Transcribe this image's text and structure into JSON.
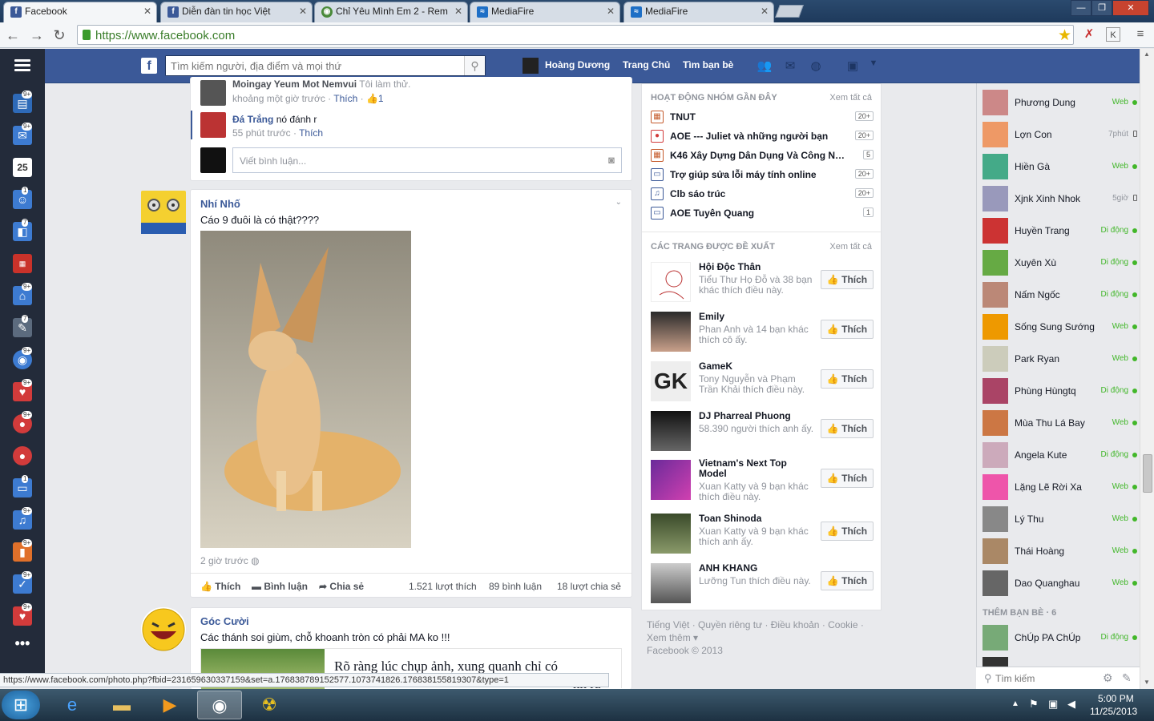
{
  "browser": {
    "tabs": [
      {
        "title": "Facebook",
        "icon": "facebook-icon",
        "active": true
      },
      {
        "title": "Diễn đàn tin học Việt",
        "icon": "facebook-icon"
      },
      {
        "title": "Chỉ Yêu Mình Em 2 - Rem",
        "icon": "chrome-icon"
      },
      {
        "title": "MediaFire",
        "icon": "mediafire-icon"
      },
      {
        "title": "MediaFire",
        "icon": "mediafire-icon"
      }
    ],
    "url": "https://www.facebook.com",
    "status_url": "https://www.facebook.com/photo.php?fbid=231659630337159&set=a.176838789152577.1073741826.176838155819307&type=1"
  },
  "fb_header": {
    "search_placeholder": "Tìm kiếm người, địa điểm và mọi thứ",
    "user_name": "Hoàng Dương",
    "home": "Trang Chủ",
    "find_friends": "Tìm bạn bè"
  },
  "app_badges": [
    "9+",
    "9+",
    "25",
    "1",
    "7",
    "",
    "9+",
    "7",
    "9+",
    "9+",
    "9+",
    "",
    "1",
    "9+",
    "9+",
    "9+",
    "9+"
  ],
  "comments": [
    {
      "name": "Moingay Yeum Mot Nemvui",
      "text": "Tôi làm thử.",
      "time": "khoảng một giờ trước",
      "like": "Thích",
      "likes": "1"
    },
    {
      "name": "Đá Trắng",
      "text": "nó đánh r",
      "time": "55 phút trước",
      "like": "Thích"
    }
  ],
  "comment_placeholder": "Viết bình luận...",
  "post1": {
    "author": "Nhí Nhố",
    "text": "Cáo 9 đuôi là có thật????",
    "time": "2 giờ trước",
    "actions": {
      "like": "Thích",
      "comment": "Bình luận",
      "share": "Chia sẻ"
    },
    "stats": {
      "likes": "1.521 lượt thích",
      "comments": "89 bình luận",
      "shares": "18 lượt chia sẻ"
    }
  },
  "post2": {
    "author": "Góc Cười",
    "text": "Các thánh soi giùm, chỗ khoanh tròn có phải MA ko !!!",
    "preview_text": "Rõ ràng lúc chụp ảnh, xung quanh chỉ có",
    "preview_text2": "nh ra thì..."
  },
  "groups": {
    "heading": "HOẠT ĐỘNG NHÓM GẦN ĐÂY",
    "see_all": "Xem tất cả",
    "items": [
      {
        "name": "TNUT",
        "count": "20+"
      },
      {
        "name": "AOE --- Juliet và những người bạn",
        "count": "20+"
      },
      {
        "name": "K46 Xây Dựng Dân Dụng Và Công Ng...",
        "count": "5"
      },
      {
        "name": "Trợ giúp sửa lỗi máy tính online",
        "count": "20+"
      },
      {
        "name": "Clb sáo trúc",
        "count": "20+"
      },
      {
        "name": "AOE Tuyên Quang",
        "count": "1"
      }
    ]
  },
  "pages": {
    "heading": "CÁC TRANG ĐƯỢC ĐỀ XUẤT",
    "see_all": "Xem tất cả",
    "like_label": "Thích",
    "items": [
      {
        "name": "Hội Độc Thân",
        "desc": "Tiểu Thư Họ Đỗ và 38 bạn khác thích điều này."
      },
      {
        "name": "Emily",
        "desc": "Phan Anh và 14 bạn khác thích cô ấy."
      },
      {
        "name": "GameK",
        "desc": "Tony Nguyễn và Phạm Trần Khải thích điều này."
      },
      {
        "name": "DJ Pharreal Phuong",
        "desc": "58.390 người thích anh ấy."
      },
      {
        "name": "Vietnam's Next Top Model",
        "desc": "Xuan Katty và 9 bạn khác thích điều này."
      },
      {
        "name": "Toan Shinoda",
        "desc": "Xuan Katty và 9 bạn khác thích anh ấy."
      },
      {
        "name": "ANH KHANG",
        "desc": "Lưỡng Tun thích điều này."
      }
    ]
  },
  "footer": {
    "line1": "Tiếng Việt · Quyền riêng tư · Điều khoản · Cookie ·",
    "line2": "Xem thêm ▾",
    "line3": "Facebook © 2013"
  },
  "chat": {
    "friends": [
      {
        "name": "Phương Dung",
        "status": "Web"
      },
      {
        "name": "Lợn Con",
        "status": "7phút",
        "idle": true
      },
      {
        "name": "Hiền Gà",
        "status": "Web"
      },
      {
        "name": "Xjnk Xinh Nhok",
        "status": "5giờ",
        "idle": true
      },
      {
        "name": "Huyền Trang",
        "status": "Di động"
      },
      {
        "name": "Xuyên Xù",
        "status": "Di động"
      },
      {
        "name": "Nấm Ngốc",
        "status": "Di động"
      },
      {
        "name": "Sống Sung Sướng",
        "status": "Web"
      },
      {
        "name": "Park Ryan",
        "status": "Web"
      },
      {
        "name": "Phùng Hùngtq",
        "status": "Di động"
      },
      {
        "name": "Mùa Thu Lá Bay",
        "status": "Web"
      },
      {
        "name": "Angela Kute",
        "status": "Di động"
      },
      {
        "name": "Lặng Lẽ Rời Xa",
        "status": "Web"
      },
      {
        "name": "Lý Thu",
        "status": "Web"
      },
      {
        "name": "Thái Hoàng",
        "status": "Web"
      },
      {
        "name": "Dao Quanghau",
        "status": "Web"
      }
    ],
    "more_heading": "THÊM BẠN BÈ · 6",
    "more_friends": [
      {
        "name": "ChÚp PA ChÚp",
        "status": "Di động"
      }
    ],
    "search_placeholder": "Tìm kiếm"
  },
  "taskbar": {
    "time": "5:00 PM",
    "date": "11/25/2013"
  }
}
